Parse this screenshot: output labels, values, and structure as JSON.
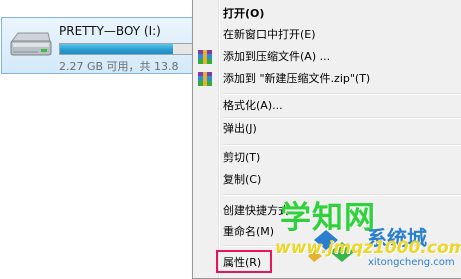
{
  "drive": {
    "name": "PRETTY—BOY (I:)",
    "space_text": "2.27 GB 可用，共 13.8",
    "used_fraction": 0.84,
    "icon": "removable-drive-icon"
  },
  "menu": {
    "open": "打开(O)",
    "open_new_window": "在新窗口中打开(E)",
    "add_to_archive": "添加到压缩文件(A) ...",
    "add_to_named_archive": "添加到 \"新建压缩文件.zip\"(T)",
    "format": "格式化(A)...",
    "eject": "弹出(J)",
    "cut": "剪切(T)",
    "copy": "复制(C)",
    "create_shortcut": "创建快捷方式",
    "rename": "重命名(M)",
    "properties": "属性(R)",
    "archive_icon": "winrar-archive-icon"
  },
  "colors": {
    "highlight_box": "#e8145f",
    "watermark_green": "#2fd23a",
    "watermark_blue": "#2a7fce"
  },
  "watermark": {
    "main": "学知网",
    "url": "www.jmqz1000.com",
    "brand": "系统城",
    "sub": "xitongcheng.com"
  }
}
